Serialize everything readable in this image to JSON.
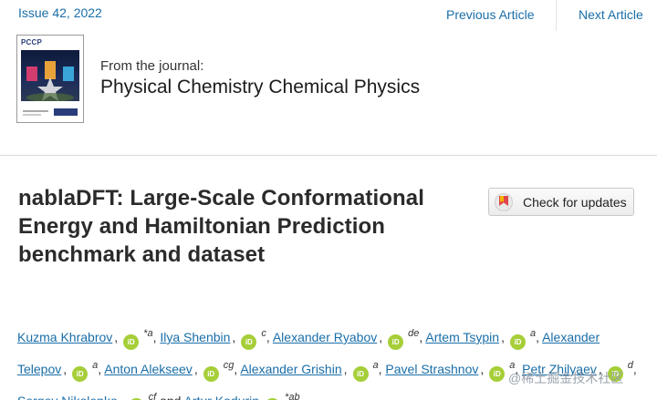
{
  "topbar": {
    "issue": "Issue 42, 2022",
    "previous": "Previous Article",
    "next": "Next Article"
  },
  "journal": {
    "cover_title": "PCCP",
    "from": "From the journal:",
    "name": "Physical Chemistry Chemical Physics"
  },
  "article": {
    "title": "nablaDFT: Large-Scale Conformational Energy and Hamiltonian Prediction benchmark and dataset",
    "check_updates": "Check for updates"
  },
  "authors": [
    {
      "name": "Kuzma Khrabrov",
      "aff": "*a"
    },
    {
      "name": "Ilya Shenbin",
      "aff": "c"
    },
    {
      "name": "Alexander Ryabov",
      "aff": "de"
    },
    {
      "name": "Artem Tsypin",
      "aff": "a"
    },
    {
      "name": "Alexander Telepov",
      "aff": "a"
    },
    {
      "name": "Anton Alekseev",
      "aff": "cg"
    },
    {
      "name": "Alexander Grishin",
      "aff": "a"
    },
    {
      "name": "Pavel Strashnov",
      "aff": "a"
    },
    {
      "name": "Petr Zhilyaev",
      "aff": "d"
    },
    {
      "name": "Sergey Nikolenko",
      "aff": "cf"
    },
    {
      "name": "Artur Kadurin",
      "aff": "*ab"
    }
  ],
  "orcid_label": "iD",
  "separator": ",",
  "and_text": "and",
  "watermark": "@稀土掘金技术社区",
  "colors": {
    "link": "#1a6ea8",
    "orcid": "#a6ce39",
    "title": "#2b2b2b"
  }
}
